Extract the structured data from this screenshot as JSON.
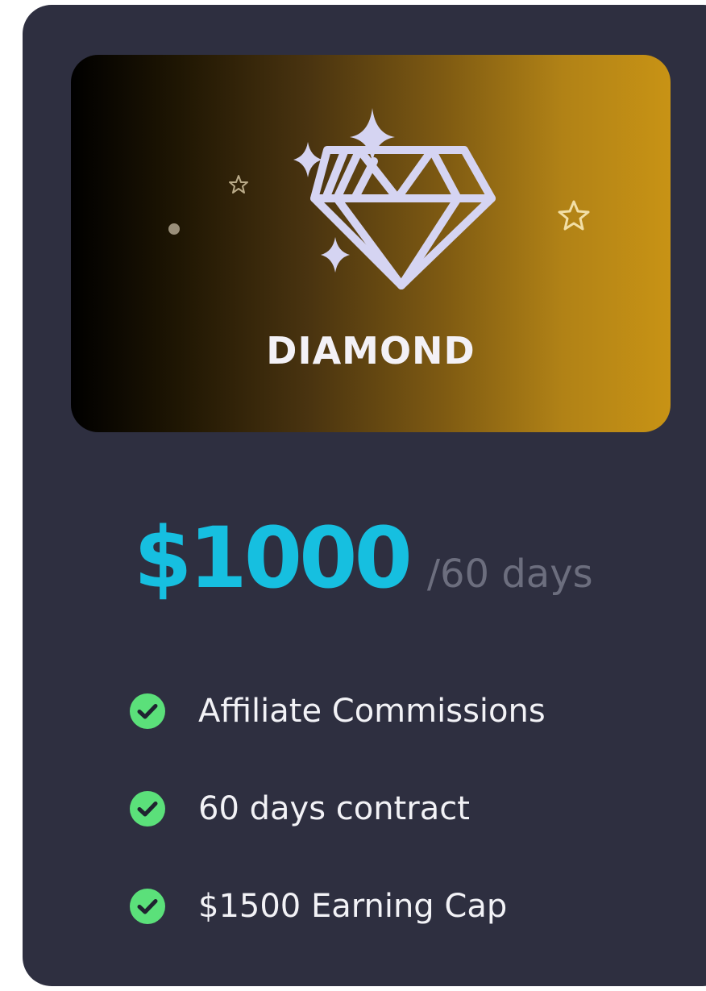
{
  "plan": {
    "name": "DIAMOND",
    "price": "$1000",
    "period": "/60 days",
    "icon": "diamond-icon"
  },
  "features": [
    {
      "label": "Affiliate Commissions",
      "icon": "check-circle-icon"
    },
    {
      "label": "60 days contract",
      "icon": "check-circle-icon"
    },
    {
      "label": "$1500 Earning Cap",
      "icon": "check-circle-icon"
    }
  ],
  "colors": {
    "card": "#2e2f40",
    "price": "#16bfe0",
    "check": "#5be07a",
    "gold": "#c89315"
  }
}
